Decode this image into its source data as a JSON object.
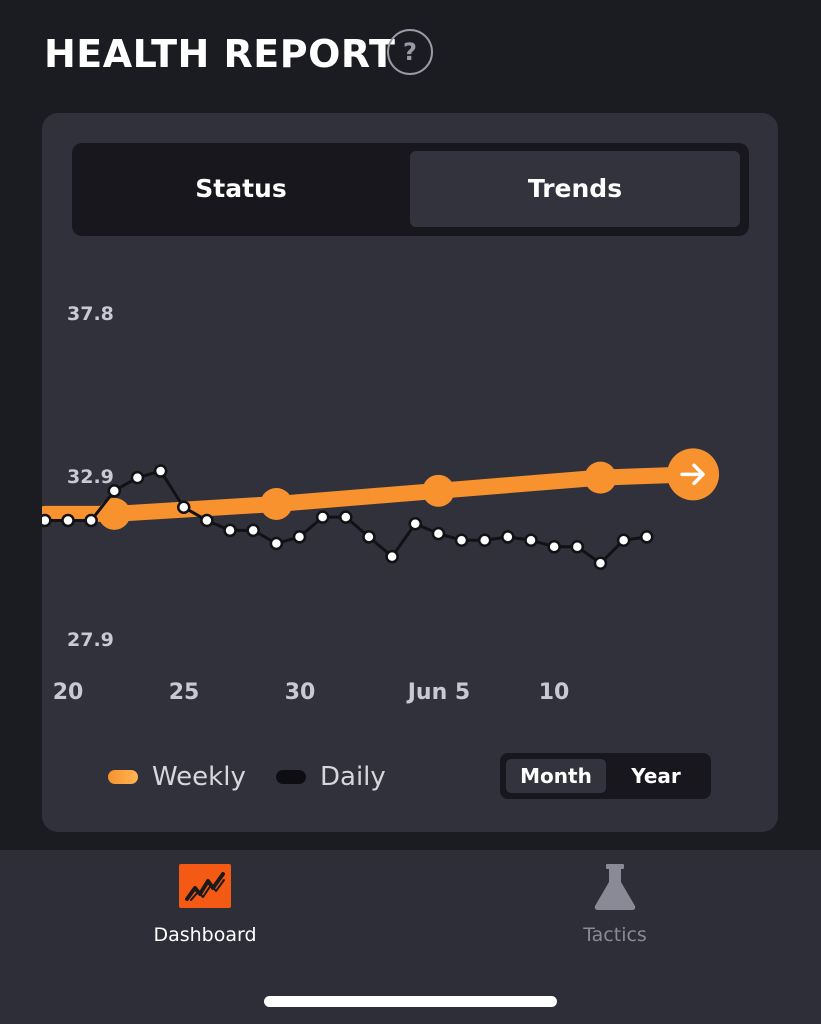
{
  "header": {
    "title": "HEALTH REPORT",
    "help_label": "?"
  },
  "segmented": {
    "tabs": [
      "Status",
      "Trends"
    ],
    "selected": "Trends"
  },
  "chart_data": {
    "type": "line",
    "y_ticks": [
      "37.8",
      "32.9",
      "27.9"
    ],
    "ylim": [
      27.9,
      37.8
    ],
    "x_ticks": [
      "20",
      "25",
      "30",
      "Jun 5",
      "10"
    ],
    "series": [
      {
        "name": "Weekly",
        "color": "#f7922f",
        "points": [
          {
            "x": "May 19",
            "y": 31.7
          },
          {
            "x": "May 22",
            "y": 31.7
          },
          {
            "x": "May 29",
            "y": 32.0
          },
          {
            "x": "Jun 5",
            "y": 32.4
          },
          {
            "x": "Jun 12",
            "y": 32.8
          },
          {
            "x": "Jun 16",
            "y": 32.9
          }
        ]
      },
      {
        "name": "Daily",
        "color": "#111116",
        "points": [
          {
            "x": "May 19",
            "y": 31.5
          },
          {
            "x": "May 20",
            "y": 31.5
          },
          {
            "x": "May 21",
            "y": 31.5
          },
          {
            "x": "May 22",
            "y": 32.4
          },
          {
            "x": "May 23",
            "y": 32.8
          },
          {
            "x": "May 24",
            "y": 33.0
          },
          {
            "x": "May 25",
            "y": 31.9
          },
          {
            "x": "May 26",
            "y": 31.5
          },
          {
            "x": "May 27",
            "y": 31.2
          },
          {
            "x": "May 28",
            "y": 31.2
          },
          {
            "x": "May 29",
            "y": 30.8
          },
          {
            "x": "May 30",
            "y": 31.0
          },
          {
            "x": "May 31",
            "y": 31.6
          },
          {
            "x": "Jun 1",
            "y": 31.6
          },
          {
            "x": "Jun 2",
            "y": 31.0
          },
          {
            "x": "Jun 3",
            "y": 30.4
          },
          {
            "x": "Jun 4",
            "y": 31.4
          },
          {
            "x": "Jun 5",
            "y": 31.1
          },
          {
            "x": "Jun 6",
            "y": 30.9
          },
          {
            "x": "Jun 7",
            "y": 30.9
          },
          {
            "x": "Jun 8",
            "y": 31.0
          },
          {
            "x": "Jun 9",
            "y": 30.9
          },
          {
            "x": "Jun 10",
            "y": 30.7
          },
          {
            "x": "Jun 11",
            "y": 30.7
          },
          {
            "x": "Jun 12",
            "y": 30.2
          },
          {
            "x": "Jun 13",
            "y": 30.9
          },
          {
            "x": "Jun 14",
            "y": 31.0
          }
        ]
      }
    ]
  },
  "legend": {
    "weekly_label": "Weekly",
    "daily_label": "Daily"
  },
  "range_toggle": {
    "options": [
      "Month",
      "Year"
    ],
    "selected": "Month"
  },
  "tabbar": {
    "items": [
      {
        "label": "Dashboard",
        "icon": "chart-icon",
        "active": true
      },
      {
        "label": "Tactics",
        "icon": "flask-icon",
        "active": false
      }
    ]
  },
  "colors": {
    "accent": "#f7922f",
    "background": "#1b1b22",
    "card": "#31313c",
    "inactive": "#8a8a96"
  }
}
